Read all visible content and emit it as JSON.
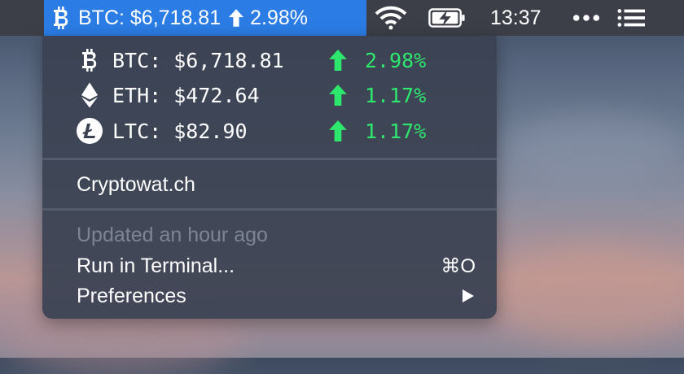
{
  "menubar": {
    "ticker_label": "BTC: $6,718.81",
    "ticker_change": "2.98%",
    "clock": "13:37"
  },
  "dropdown": {
    "coins": [
      {
        "icon": "bitcoin-icon",
        "label": "BTC: $6,718.81",
        "change": "2.98%"
      },
      {
        "icon": "ethereum-icon",
        "label": "ETH: $472.64",
        "change": "1.17%"
      },
      {
        "icon": "litecoin-icon",
        "label": "LTC: $82.90",
        "change": "1.17%"
      }
    ],
    "site_link": "Cryptowat.ch",
    "updated": "Updated an hour ago",
    "run_in_terminal": "Run in Terminal...",
    "run_shortcut": "⌘O",
    "preferences": "Preferences"
  },
  "colors": {
    "menubar_bg": "#3c3f48",
    "active_highlight": "#2b7de5",
    "positive_change": "#2ee86e",
    "dropdown_bg": "#3a4252"
  }
}
